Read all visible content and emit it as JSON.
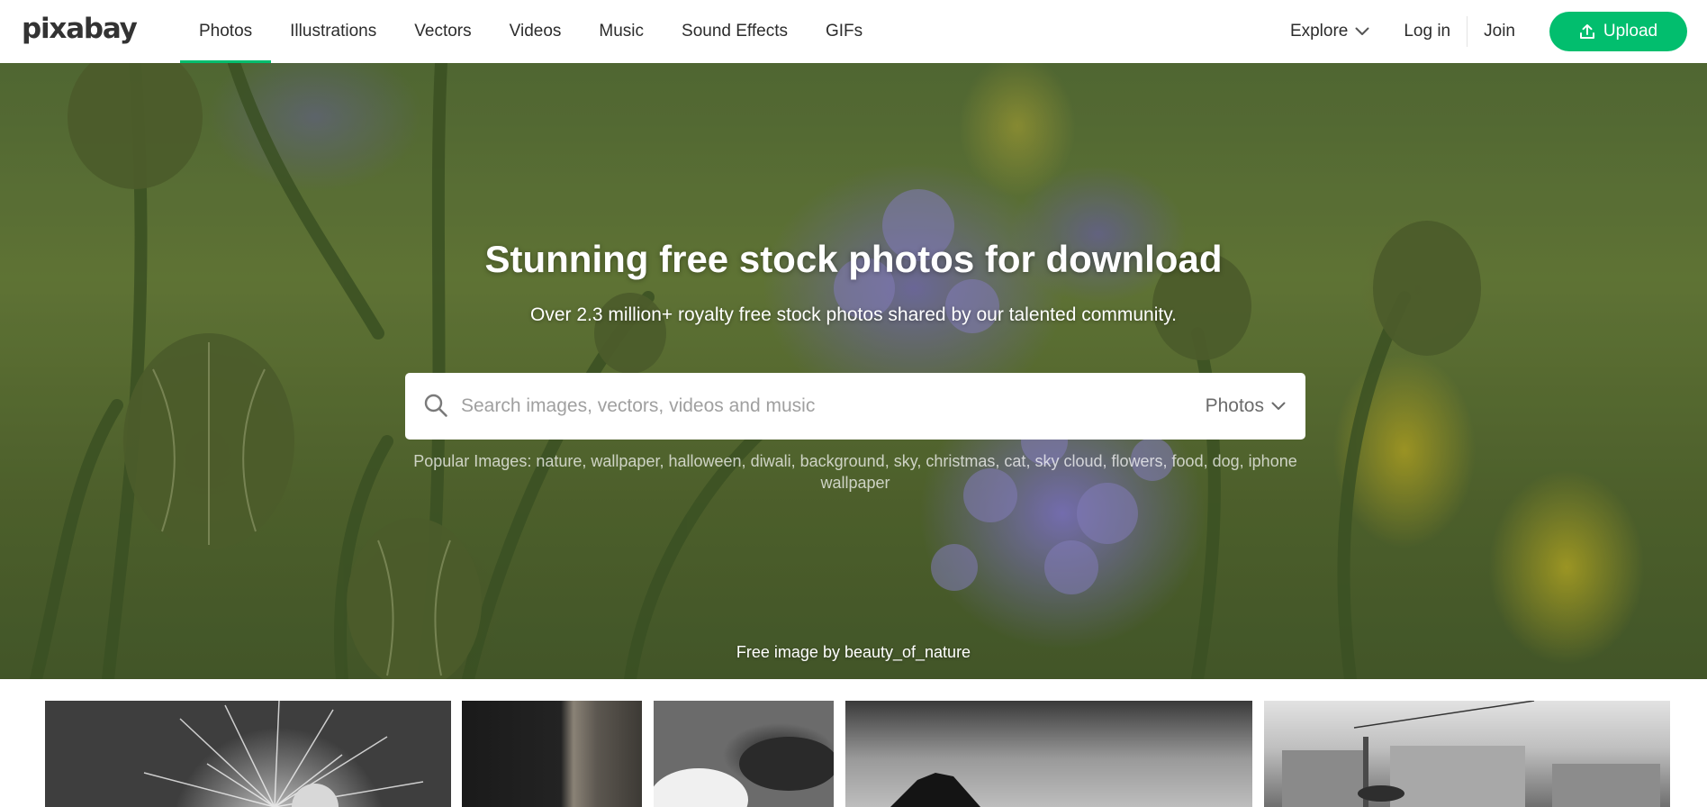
{
  "header": {
    "logo": "pixabay",
    "nav": [
      {
        "label": "Photos",
        "active": true
      },
      {
        "label": "Illustrations",
        "active": false
      },
      {
        "label": "Vectors",
        "active": false
      },
      {
        "label": "Videos",
        "active": false
      },
      {
        "label": "Music",
        "active": false
      },
      {
        "label": "Sound Effects",
        "active": false
      },
      {
        "label": "GIFs",
        "active": false
      }
    ],
    "explore_label": "Explore",
    "login_label": "Log in",
    "join_label": "Join",
    "upload_label": "Upload"
  },
  "hero": {
    "title": "Stunning free stock photos for download",
    "subtitle": "Over 2.3 million+ royalty free stock photos shared by our talented community.",
    "search": {
      "placeholder": "Search images, vectors, videos and music",
      "value": "",
      "type_selected": "Photos"
    },
    "popular_label": "Popular Images:",
    "popular_tags": [
      "nature",
      "wallpaper",
      "halloween",
      "diwali",
      "background",
      "sky",
      "christmas",
      "cat",
      "sky cloud",
      "flowers",
      "food",
      "dog",
      "iphone wallpaper"
    ],
    "credit": "Free image by beauty_of_nature"
  },
  "icons": {
    "search": "search-icon",
    "explore": "chevron-down-icon",
    "type": "chevron-down-icon",
    "upload": "upload-icon"
  },
  "colors": {
    "accent": "#02be6e",
    "text": "#2c2c2c"
  }
}
